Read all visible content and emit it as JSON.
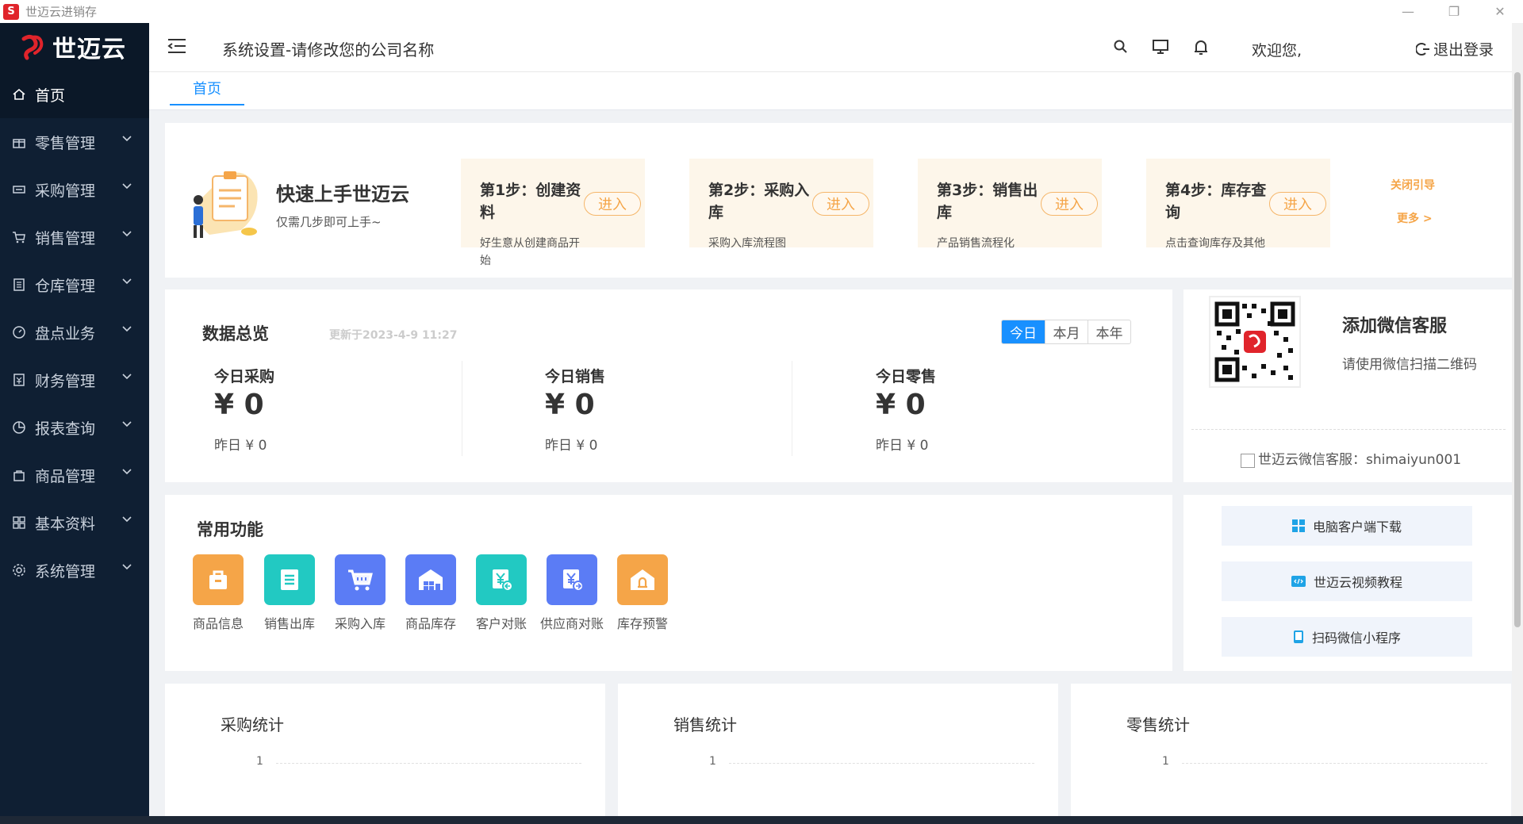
{
  "window": {
    "title": "世迈云进销存",
    "app_icon_glyph": "S"
  },
  "brand": {
    "name": "世迈云",
    "color": "#e0242b"
  },
  "sidebar": {
    "items": [
      {
        "label": "首页",
        "icon": "home-icon"
      },
      {
        "label": "零售管理",
        "icon": "gift-icon"
      },
      {
        "label": "采购管理",
        "icon": "purchase-icon"
      },
      {
        "label": "销售管理",
        "icon": "cart-icon"
      },
      {
        "label": "仓库管理",
        "icon": "warehouse-icon"
      },
      {
        "label": "盘点业务",
        "icon": "dashboard-icon"
      },
      {
        "label": "财务管理",
        "icon": "finance-icon"
      },
      {
        "label": "报表查询",
        "icon": "pie-chart-icon"
      },
      {
        "label": "商品管理",
        "icon": "bag-icon"
      },
      {
        "label": "基本资料",
        "icon": "grid-icon"
      },
      {
        "label": "系统管理",
        "icon": "gear-icon"
      }
    ]
  },
  "header": {
    "title": "系统设置-请修改您的公司名称",
    "welcome": "欢迎您,",
    "logout": "退出登录"
  },
  "tabs": [
    {
      "label": "首页"
    }
  ],
  "guide": {
    "title": "快速上手世迈云",
    "subtitle": "仅需几步即可上手~",
    "steps": [
      {
        "title": "第1步：创建资料",
        "button": "进入",
        "desc": "好生意从创建商品开始"
      },
      {
        "title": "第2步：采购入库",
        "button": "进入",
        "desc": "采购入库流程图"
      },
      {
        "title": "第3步：销售出库",
        "button": "进入",
        "desc": "产品销售流程化"
      },
      {
        "title": "第4步：库存查询",
        "button": "进入",
        "desc": "点击查询库存及其他"
      }
    ],
    "close": "关闭引导",
    "more": "更多 >"
  },
  "overview": {
    "title": "数据总览",
    "updated": "更新于2023-4-9 11:27",
    "ranges": [
      "今日",
      "本月",
      "本年"
    ],
    "stats": [
      {
        "label": "今日采购",
        "value": "¥ 0",
        "prev": "昨日 ¥ 0"
      },
      {
        "label": "今日销售",
        "value": "¥ 0",
        "prev": "昨日 ¥ 0"
      },
      {
        "label": "今日零售",
        "value": "¥ 0",
        "prev": "昨日 ¥ 0"
      }
    ]
  },
  "wechat": {
    "title": "添加微信客服",
    "subtitle": "请使用微信扫描二维码",
    "id_text": "世迈云微信客服：shimaiyun001"
  },
  "functions": {
    "title": "常用功能",
    "items": [
      {
        "label": "商品信息",
        "color": "#f5a548",
        "icon": "bag-icon"
      },
      {
        "label": "销售出库",
        "color": "#22c9c2",
        "icon": "document-icon"
      },
      {
        "label": "采购入库",
        "color": "#5b7cf5",
        "icon": "cart-icon"
      },
      {
        "label": "商品库存",
        "color": "#5b7cf5",
        "icon": "warehouse-icon"
      },
      {
        "label": "客户对账",
        "color": "#22c9c2",
        "icon": "yen-icon"
      },
      {
        "label": "供应商对账",
        "color": "#5b7cf5",
        "icon": "yen-icon"
      },
      {
        "label": "库存预警",
        "color": "#f5a548",
        "icon": "alert-house-icon"
      }
    ]
  },
  "links": [
    {
      "label": "电脑客户端下载",
      "icon": "windows-icon"
    },
    {
      "label": "世迈云视频教程",
      "icon": "video-icon"
    },
    {
      "label": "扫码微信小程序",
      "icon": "mobile-icon"
    }
  ],
  "charts": [
    {
      "title": "采购统计",
      "tick": "1"
    },
    {
      "title": "销售统计",
      "tick": "1"
    },
    {
      "title": "零售统计",
      "tick": "1"
    }
  ],
  "accent": "#1890ff",
  "guide_accent": "#f5a548"
}
